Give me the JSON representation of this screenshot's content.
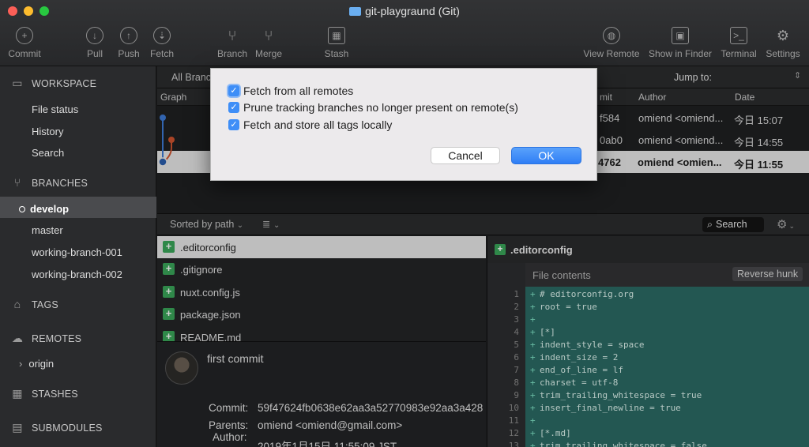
{
  "window": {
    "title": "git-playgraund (Git)"
  },
  "toolbar": {
    "commit": "Commit",
    "pull": "Pull",
    "push": "Push",
    "fetch": "Fetch",
    "branch": "Branch",
    "merge": "Merge",
    "stash": "Stash",
    "view_remote": "View Remote",
    "show_in_finder": "Show in Finder",
    "terminal": "Terminal",
    "settings": "Settings"
  },
  "sidebar": {
    "workspace": "WORKSPACE",
    "workspace_items": [
      "File status",
      "History",
      "Search"
    ],
    "branches": "BRANCHES",
    "branch_items": [
      "develop",
      "master",
      "working-branch-001",
      "working-branch-002"
    ],
    "tags": "TAGS",
    "remotes": "REMOTES",
    "remote_items": [
      "origin"
    ],
    "stashes": "STASHES",
    "submodules": "SUBMODULES"
  },
  "branchbar": {
    "all_branches": "All Branc",
    "jump_to": "Jump to:"
  },
  "columns": {
    "graph": "Graph",
    "commit": "mit",
    "author": "Author",
    "date": "Date"
  },
  "commits": [
    {
      "hash": "f584",
      "author": "omiend <omiend...",
      "date": "今日 15:07"
    },
    {
      "hash": "0ab0",
      "author": "omiend <omiend...",
      "date": "今日 14:55"
    },
    {
      "hash": "4762",
      "author": "omiend <omien...",
      "date": "今日 11:55"
    }
  ],
  "filebar": {
    "sorted": "Sorted by path",
    "search": "Search"
  },
  "files": [
    ".editorconfig",
    ".gitignore",
    "nuxt.config.js",
    "package.json",
    "README.md"
  ],
  "detail": {
    "message": "first commit",
    "commit_label": "Commit:",
    "commit_value": "59f47624fb0638e62aa3a52770983e92aa3a428",
    "parents_label": "Parents:",
    "parents_value": "omiend <omiend@gmail.com>",
    "author_label": "Author:",
    "date_value": "2019年1月15日 11:55:09 JST"
  },
  "diff": {
    "file": ".editorconfig",
    "hunk_title": "File contents",
    "reverse_hunk": "Reverse hunk",
    "lines": [
      {
        "n": "1",
        "t": "# editorconfig.org"
      },
      {
        "n": "2",
        "t": "root = true"
      },
      {
        "n": "3",
        "t": ""
      },
      {
        "n": "4",
        "t": "[*]"
      },
      {
        "n": "5",
        "t": "indent_style = space"
      },
      {
        "n": "6",
        "t": "indent_size = 2"
      },
      {
        "n": "7",
        "t": "end_of_line = lf"
      },
      {
        "n": "8",
        "t": "charset = utf-8"
      },
      {
        "n": "9",
        "t": "trim_trailing_whitespace = true"
      },
      {
        "n": "10",
        "t": "insert_final_newline = true"
      },
      {
        "n": "11",
        "t": ""
      },
      {
        "n": "12",
        "t": "[*.md]"
      },
      {
        "n": "13",
        "t": "trim_trailing_whitespace = false"
      }
    ]
  },
  "dialog": {
    "options": [
      "Fetch from all remotes",
      "Prune tracking branches no longer present on remote(s)",
      "Fetch and store all tags locally"
    ],
    "cancel": "Cancel",
    "ok": "OK"
  },
  "colors": {
    "accent": "#3e8ef7",
    "added": "#3aa65a",
    "diff_bg": "#2b6b64"
  }
}
